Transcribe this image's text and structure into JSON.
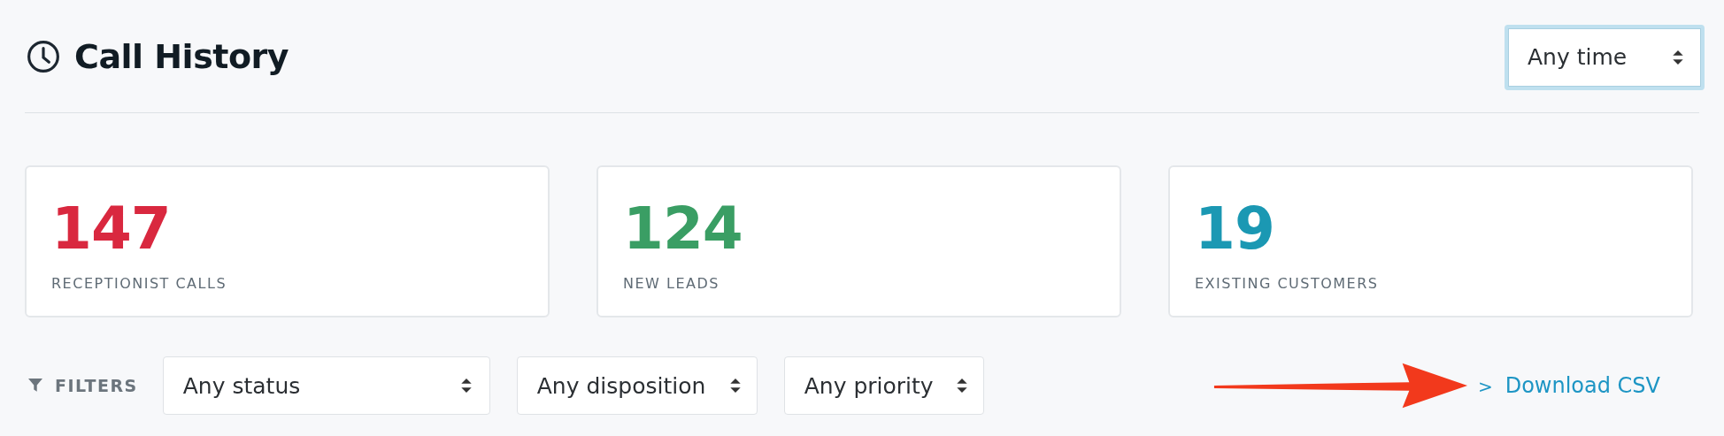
{
  "header": {
    "title": "Call History",
    "time_select": {
      "value": "Any time",
      "focused": true
    }
  },
  "stats": [
    {
      "value": "147",
      "label": "RECEPTIONIST CALLS",
      "color": "#d9283f"
    },
    {
      "value": "124",
      "label": "NEW LEADS",
      "color": "#3a9e64"
    },
    {
      "value": "19",
      "label": "EXISTING CUSTOMERS",
      "color": "#1b98b3"
    }
  ],
  "filters": {
    "label": "FILTERS",
    "selects": [
      {
        "value": "Any status"
      },
      {
        "value": "Any disposition"
      },
      {
        "value": "Any priority"
      }
    ]
  },
  "download": {
    "chevron": ">",
    "label": "Download CSV"
  }
}
